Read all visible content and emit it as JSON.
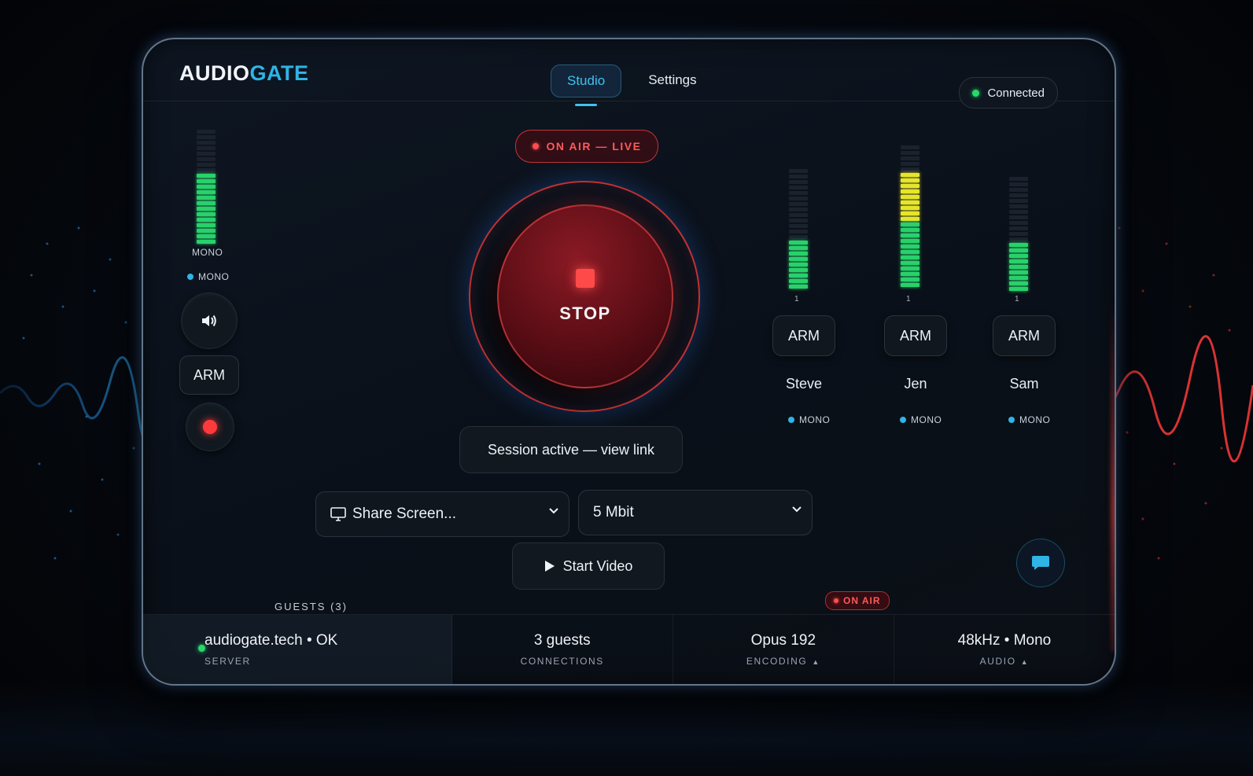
{
  "app": {
    "logo_primary": "AUDIO",
    "logo_accent": "GATE",
    "accent_color": "#2fb4e6",
    "live_color": "#ff4a4a"
  },
  "nav": {
    "tabs": [
      {
        "label": "Studio",
        "active": true
      },
      {
        "label": "Settings",
        "active": false
      }
    ]
  },
  "connection": {
    "label": "Connected",
    "status_color": "#27d86a"
  },
  "host": {
    "meter_label": "MONO",
    "mode_label": "MONO",
    "meter_level": 0.6,
    "speaker_icon": "speaker-icon",
    "arm_label": "ARM",
    "record_icon": "record-dot-icon"
  },
  "onair": {
    "badge": "ON AIR — LIVE"
  },
  "stop_button": {
    "label": "STOP",
    "icon": "stop-square-icon"
  },
  "session": {
    "label": "Session active — view link"
  },
  "controls": {
    "share_screen": {
      "value": "Share Screen...",
      "icon": "monitor-icon"
    },
    "bitrate": {
      "value": "5 Mbit"
    },
    "start_video": {
      "label": "Start Video",
      "icon": "play-icon"
    }
  },
  "guests": {
    "section_label": "GUESTS (3)",
    "list": [
      {
        "name": "Steve",
        "arm_label": "ARM",
        "mode": "MONO",
        "channel": "1",
        "level": 0.4,
        "peak_color": "#29d16b"
      },
      {
        "name": "Jen",
        "arm_label": "ARM",
        "mode": "MONO",
        "channel": "1",
        "level": 0.82,
        "peak_color": "#e6e52c"
      },
      {
        "name": "Sam",
        "arm_label": "ARM",
        "mode": "MONO",
        "channel": "1",
        "level": 0.45,
        "peak_color": "#29d16b"
      }
    ]
  },
  "chat": {
    "icon": "chat-bubble-icon"
  },
  "onair_small": {
    "label": "ON AIR"
  },
  "footer": {
    "server": {
      "value": "audiogate.tech • OK",
      "label": "SERVER"
    },
    "connections": {
      "value": "3 guests",
      "label": "CONNECTIONS"
    },
    "encoding": {
      "value": "Opus 192",
      "label": "ENCODING"
    },
    "audio": {
      "value": "48kHz • Mono",
      "label": "AUDIO"
    }
  }
}
